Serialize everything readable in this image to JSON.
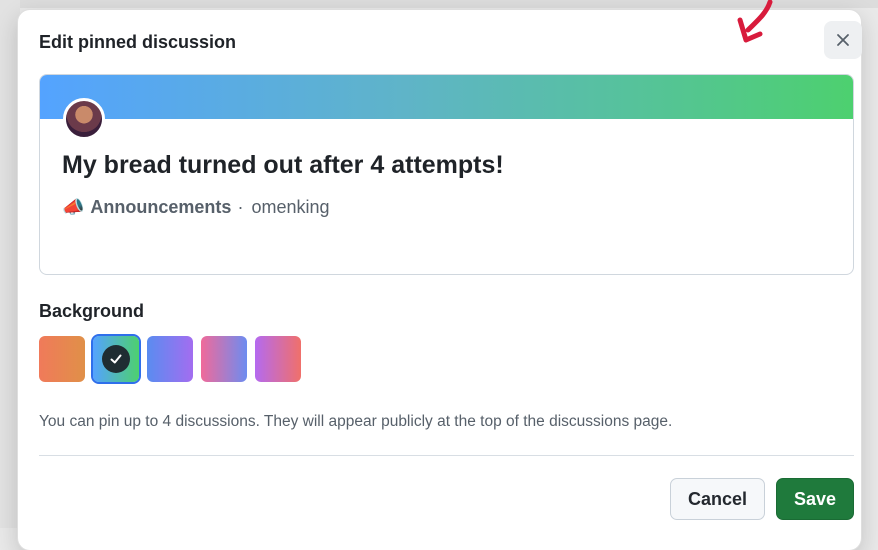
{
  "dialog": {
    "title": "Edit pinned discussion",
    "close_icon": "close-icon"
  },
  "preview": {
    "title": "My bread turned out after 4 attempts!",
    "category_icon": "megaphone-icon",
    "category_glyph": "📣",
    "category": "Announcements",
    "separator": "·",
    "author": "omenking",
    "banner_colors": [
      "#54a3ff",
      "#4dd06f"
    ]
  },
  "background": {
    "label": "Background",
    "swatches": [
      {
        "name": "orange",
        "colors": [
          "#f07a5a",
          "#e09048"
        ],
        "selected": false
      },
      {
        "name": "blue-green",
        "colors": [
          "#54a3ff",
          "#4dd06f"
        ],
        "selected": true
      },
      {
        "name": "blue-purple",
        "colors": [
          "#5a8cf0",
          "#a36df0"
        ],
        "selected": false
      },
      {
        "name": "pink-blue",
        "colors": [
          "#f06a9a",
          "#6d8cf0"
        ],
        "selected": false
      },
      {
        "name": "purple-red",
        "colors": [
          "#b46af0",
          "#f0706a"
        ],
        "selected": false
      }
    ]
  },
  "help_text": "You can pin up to 4 discussions. They will appear publicly at the top of the discussions page.",
  "actions": {
    "cancel_label": "Cancel",
    "save_label": "Save"
  }
}
